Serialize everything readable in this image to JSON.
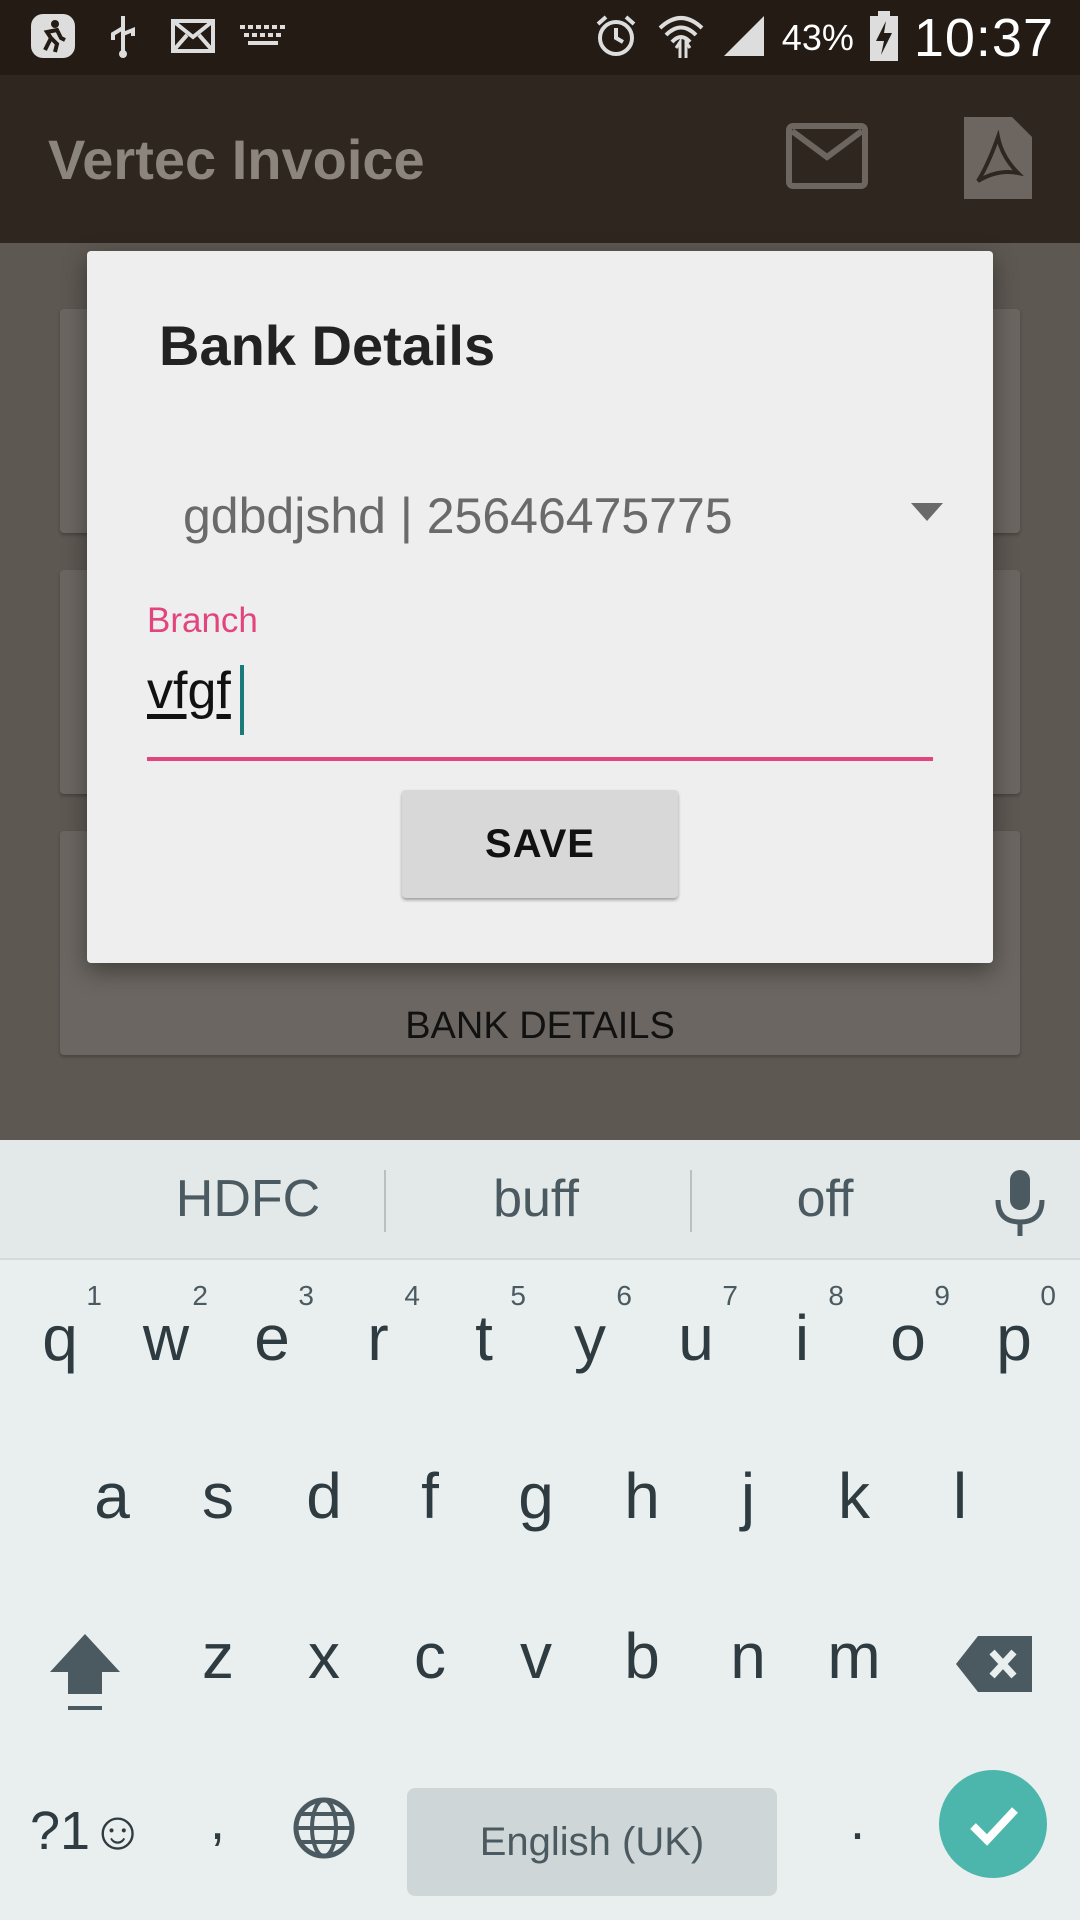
{
  "status_bar": {
    "battery_percent": "43%",
    "time": "10:37",
    "left_icons": [
      "fitness-icon",
      "usb-icon",
      "mail-icon",
      "keyboard-icon"
    ],
    "right_icons": [
      "alarm-icon",
      "wifi-icon",
      "signal-icon",
      "battery-charging-icon"
    ]
  },
  "app_bar": {
    "title": "Vertec Invoice",
    "actions": [
      "mail-icon",
      "pdf-icon"
    ]
  },
  "background": {
    "bank_details_label": "BANK DETAILS"
  },
  "dialog": {
    "title": "Bank Details",
    "account_spinner_value": "gdbdjshd | 25646475775",
    "branch_label": "Branch",
    "branch_value": "vfgf",
    "save_label": "SAVE"
  },
  "keyboard": {
    "suggestions": [
      "HDFC",
      "buff",
      "off"
    ],
    "row1": [
      {
        "ch": "q",
        "num": "1"
      },
      {
        "ch": "w",
        "num": "2"
      },
      {
        "ch": "e",
        "num": "3"
      },
      {
        "ch": "r",
        "num": "4"
      },
      {
        "ch": "t",
        "num": "5"
      },
      {
        "ch": "y",
        "num": "6"
      },
      {
        "ch": "u",
        "num": "7"
      },
      {
        "ch": "i",
        "num": "8"
      },
      {
        "ch": "o",
        "num": "9"
      },
      {
        "ch": "p",
        "num": "0"
      }
    ],
    "row2": [
      "a",
      "s",
      "d",
      "f",
      "g",
      "h",
      "j",
      "k",
      "l"
    ],
    "row3": [
      "z",
      "x",
      "c",
      "v",
      "b",
      "n",
      "m"
    ],
    "symbols_label": "?1☺",
    "comma": ",",
    "period": ".",
    "space_label": "English (UK)"
  },
  "colors": {
    "accent": "#e2457d",
    "enter_key": "#4db6ac",
    "status_bar": "#231b14"
  }
}
